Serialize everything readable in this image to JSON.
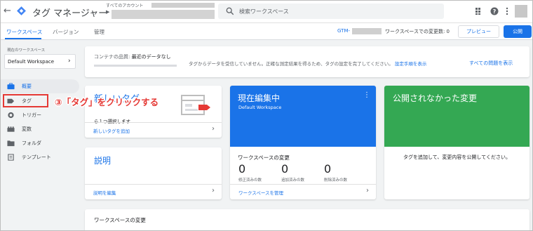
{
  "topbar": {
    "app_title": "タグ マネージャー",
    "account_label": "すべてのアカウント",
    "search_placeholder": "検索ワークスペース"
  },
  "navbar": {
    "tabs": [
      "ワークスペース",
      "バージョン",
      "管理"
    ],
    "active_tab": "ワークスペース",
    "gtm_prefix": "GTM-",
    "changes_text": "ワークスペースでの変更数: 0",
    "preview_label": "プレビュー",
    "publish_label": "公開"
  },
  "sidebar": {
    "workspace_label": "現在のワークスペース",
    "workspace_name": "Default Workspace",
    "items": [
      {
        "label": "概要",
        "icon": "briefcase-icon",
        "active": true
      },
      {
        "label": "タグ",
        "icon": "tag-icon",
        "active": false
      },
      {
        "label": "トリガー",
        "icon": "trigger-icon",
        "active": false
      },
      {
        "label": "変数",
        "icon": "variables-icon",
        "active": false
      },
      {
        "label": "フォルダ",
        "icon": "folder-icon",
        "active": false
      },
      {
        "label": "テンプレート",
        "icon": "template-icon",
        "active": false
      }
    ]
  },
  "annotation": {
    "callout_text": "③「タグ」をクリックする",
    "highlight_color": "#e53935"
  },
  "quality": {
    "label": "コンテナの品質:",
    "value": "最近のデータなし",
    "message": "タグからデータを受信していません。正確な測定結果を得るため、タグの設定を完了してください。",
    "setup_link": "設定手順を表示",
    "all_issues_link": "すべての問題を表示"
  },
  "new_tag_card": {
    "title": "新しいタグ",
    "description": "ら１つ選択します",
    "footer_link": "新しいタグを追加"
  },
  "description_card": {
    "title": "説明",
    "footer_link": "説明を編集"
  },
  "editing_card": {
    "title": "現在編集中",
    "workspace": "Default Workspace",
    "changes_title": "ワークスペースの変更",
    "stats": [
      {
        "value": "0",
        "label": "修正済みの数"
      },
      {
        "value": "0",
        "label": "追加済みの数"
      },
      {
        "value": "0",
        "label": "削除済みの数"
      }
    ],
    "footer_link": "ワークスペースを管理",
    "color": "#1a73e8"
  },
  "unpublished_card": {
    "title": "公開されなかった変更",
    "message": "タグを追加して、変更内容を公開してください。",
    "color": "#34a853"
  },
  "workspace_changes_card": {
    "title": "ワークスペースの変更"
  }
}
